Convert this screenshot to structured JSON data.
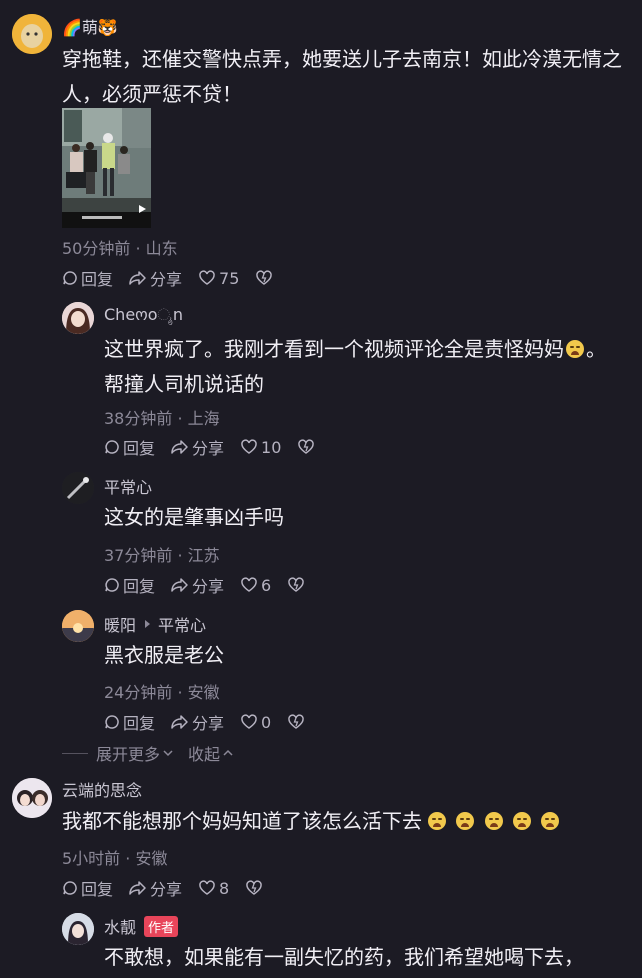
{
  "comments": [
    {
      "username": "🌈萌🐯",
      "text": "穿拖鞋，还催交警快点弄，她要送儿子去南京！如此冷漠无情之人，必须严惩不贷！",
      "meta": "50分钟前 · 山东",
      "reply": "回复",
      "share": "分享",
      "likes": "75"
    },
    {
      "username": "Cheოoೖn",
      "text_before_emoji": "这世界疯了。我刚才看到一个视频评论全是责怪妈妈",
      "text_after_emoji": "。帮撞人司机说话的",
      "meta": "38分钟前 · 上海",
      "reply": "回复",
      "share": "分享",
      "likes": "10"
    },
    {
      "username": "平常心",
      "text": "这女的是肇事凶手吗",
      "meta": "37分钟前 · 江苏",
      "reply": "回复",
      "share": "分享",
      "likes": "6"
    },
    {
      "username": "暖阳",
      "reply_to": "平常心",
      "text": "黑衣服是老公",
      "meta": "24分钟前 · 安徽",
      "reply": "回复",
      "share": "分享",
      "likes": "0"
    },
    {
      "username": "云端的思念",
      "text": "我都不能想那个妈妈知道了该怎么活下去",
      "meta": "5小时前 · 安徽",
      "reply": "回复",
      "share": "分享",
      "likes": "8"
    },
    {
      "username": "水靓",
      "author_tag": "作者",
      "text": "不敢想，如果能有一副失忆的药，我们希望她喝下去，"
    }
  ],
  "expand": {
    "more": "展开更多",
    "collapse": "收起"
  },
  "icons": [
    "reply-icon",
    "share-icon",
    "like-icon",
    "dislike-icon",
    "play-icon",
    "chevron-down-icon",
    "chevron-up-icon",
    "reply-arrow-icon"
  ]
}
